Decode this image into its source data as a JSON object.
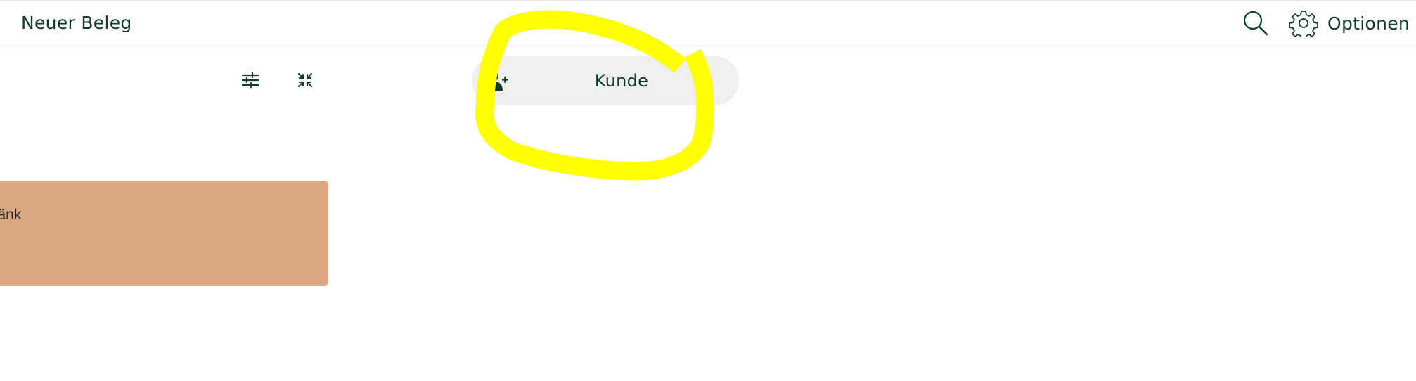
{
  "header": {
    "title": "Neuer Beleg",
    "search_icon": "search-icon",
    "options_icon": "gear-icon",
    "options_label": "Optionen"
  },
  "toolbar": {
    "filter_icon": "sliders-icon",
    "collapse_icon": "collapse-arrows-icon"
  },
  "customer": {
    "icon": "user-plus-icon",
    "label": "Kunde"
  },
  "products": [
    {
      "label": "etränk",
      "color": "#dba681"
    }
  ],
  "colors": {
    "text_primary": "#0e3b2e",
    "pill_background": "#efeff0",
    "divider": "#edf0ee",
    "highlight_annotation": "#ffff00"
  }
}
